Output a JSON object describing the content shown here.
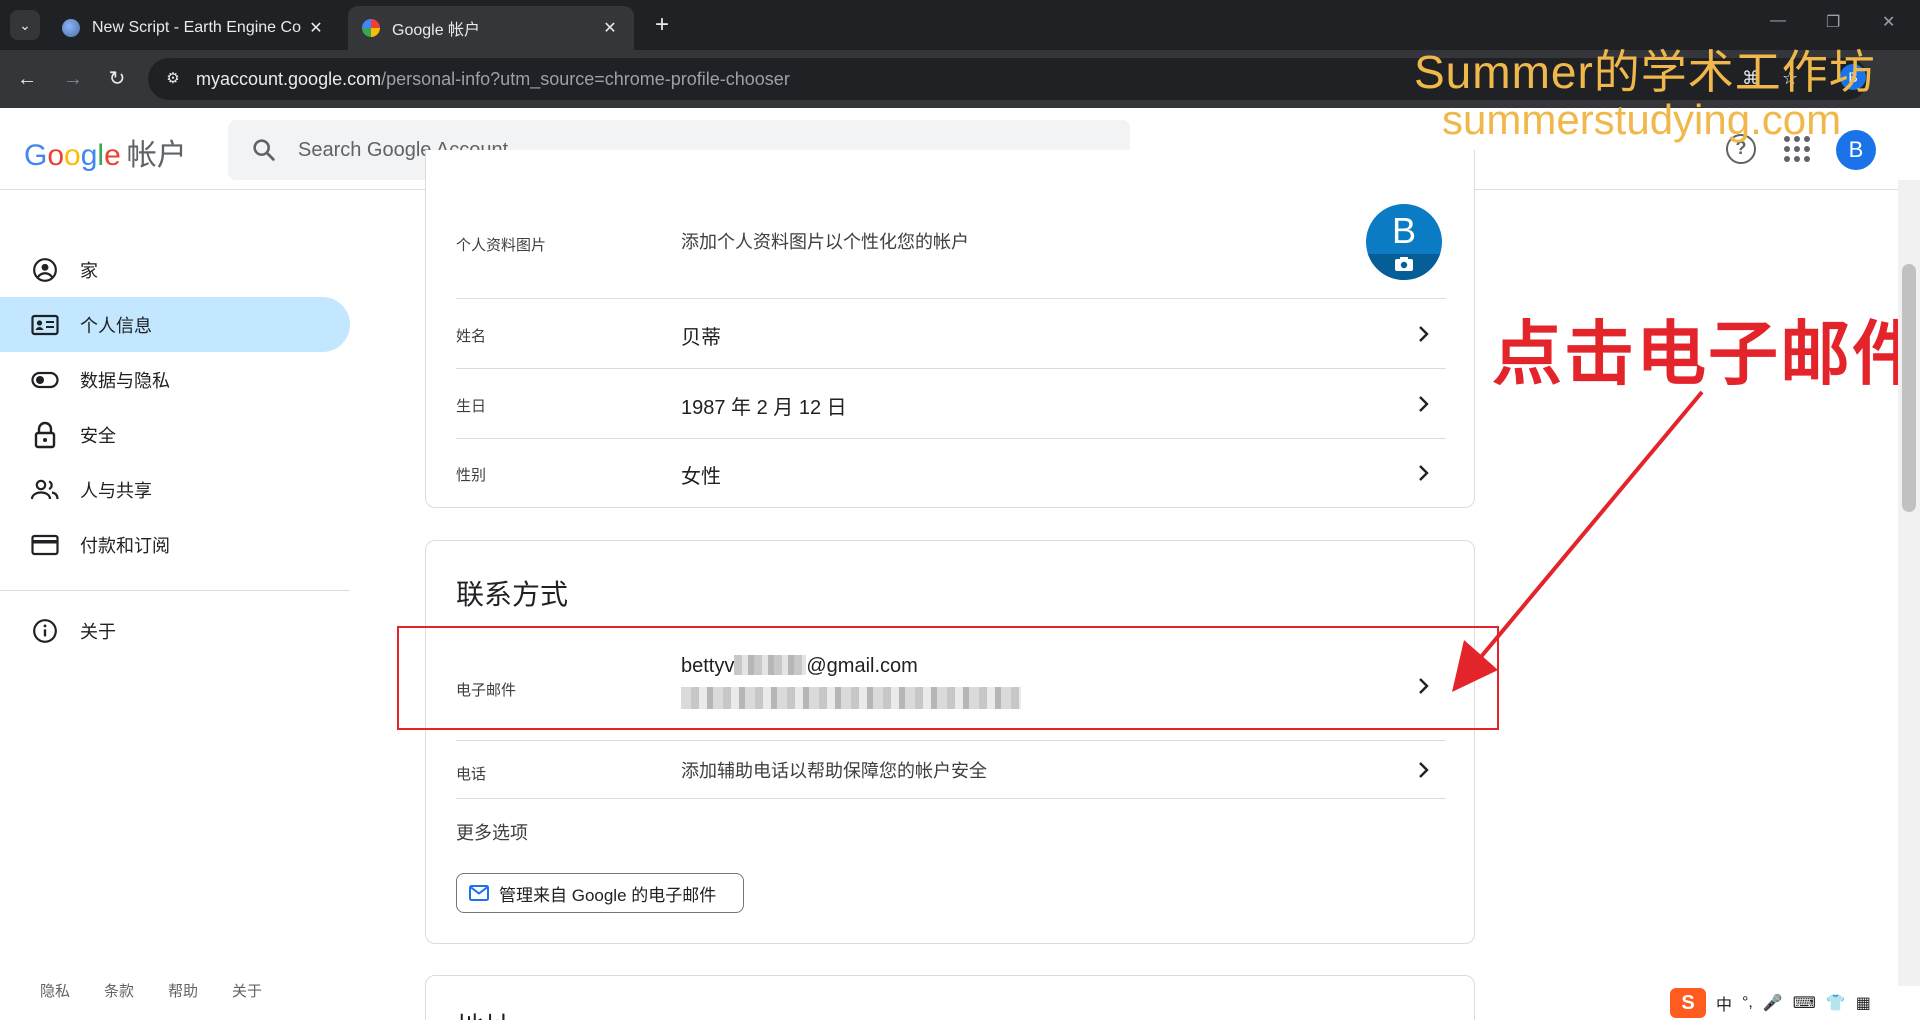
{
  "browser": {
    "tabs": [
      {
        "title": "New Script - Earth Engine Co",
        "active": false
      },
      {
        "title": "Google 帐户",
        "active": true
      }
    ],
    "new_tab": "+",
    "url_host": "myaccount.google.com",
    "url_path": "/personal-info?utm_source=chrome-profile-chooser",
    "profile_initial": "B"
  },
  "watermark": {
    "line1": "Summer的学术工作坊",
    "line2": "summerstudying.com"
  },
  "header": {
    "logo_letters": [
      "G",
      "o",
      "o",
      "g",
      "l",
      "e"
    ],
    "product": "帐户",
    "search_placeholder": "Search Google Account",
    "avatar_initial": "B"
  },
  "sidebar": {
    "items": [
      {
        "label": "家",
        "icon": "account-circle-icon",
        "active": false
      },
      {
        "label": "个人信息",
        "icon": "id-card-icon",
        "active": true
      },
      {
        "label": "数据与隐私",
        "icon": "toggle-icon",
        "active": false
      },
      {
        "label": "安全",
        "icon": "lock-icon",
        "active": false
      },
      {
        "label": "人与共享",
        "icon": "people-icon",
        "active": false
      },
      {
        "label": "付款和订阅",
        "icon": "credit-card-icon",
        "active": false
      }
    ],
    "about": {
      "label": "关于",
      "icon": "info-icon"
    },
    "footer": [
      "隐私",
      "条款",
      "帮助",
      "关于"
    ]
  },
  "basic_info": {
    "rows": [
      {
        "label": "个人资料图片",
        "value": "添加个人资料图片以个性化您的帐户"
      },
      {
        "label": "姓名",
        "value": "贝蒂"
      },
      {
        "label": "生日",
        "value": "1987 年 2 月 12 日"
      },
      {
        "label": "性别",
        "value": "女性"
      }
    ],
    "photo_initial": "B"
  },
  "contact": {
    "title": "联系方式",
    "email_label": "电子邮件",
    "email_prefix": "bettyv",
    "email_suffix": "@gmail.com",
    "phone_label": "电话",
    "phone_value": "添加辅助电话以帮助保障您的帐户安全",
    "more_options": "更多选项",
    "manage_button": "管理来自 Google 的电子邮件"
  },
  "address": {
    "title": "地址"
  },
  "annotation": {
    "text": "点击电子邮件",
    "color": "#e3242b"
  },
  "ime": {
    "logo": "S",
    "mode": "中",
    "punct": "°,"
  }
}
